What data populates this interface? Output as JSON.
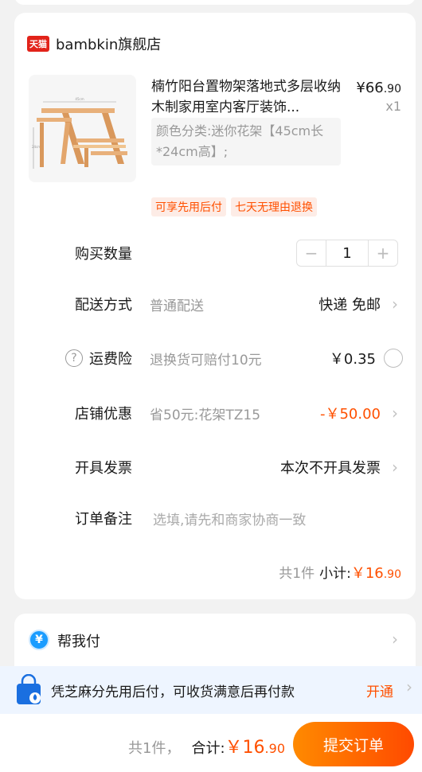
{
  "shop": {
    "badge": "天猫",
    "name": "bambkin旗舰店"
  },
  "product": {
    "title": "楠竹阳台置物架落地式多层收纳木制家用室内客厅装饰...",
    "price_symbol": "¥",
    "price_int": "66",
    "price_dec": ".90",
    "quantity_label": "x1",
    "sku": "颜色分类:迷你花架【45cm长*24cm高】;",
    "thumb_dim_top": "45cm",
    "thumb_dim_side": "24cm",
    "tags": [
      "可享先用后付",
      "七天无理由退换"
    ]
  },
  "rows": {
    "quantity": {
      "label": "购买数量",
      "minus": "−",
      "value": "1",
      "plus": "+"
    },
    "delivery": {
      "label": "配送方式",
      "desc": "普通配送",
      "value": "快递 免邮"
    },
    "insurance": {
      "label": "运费险",
      "desc": "退换货可赔付10元",
      "value": "￥0.35"
    },
    "discount": {
      "label": "店铺优惠",
      "desc": "省50元:花架TZ15",
      "value": "-￥50.00"
    },
    "invoice": {
      "label": "开具发票",
      "value": "本次不开具发票"
    },
    "note": {
      "label": "订单备注",
      "placeholder": "选填,请先和商家协商一致"
    }
  },
  "subtotal": {
    "count": "共1件",
    "label": "小计:",
    "symbol": "￥",
    "int": "16",
    "dec": ".90"
  },
  "help_pay": {
    "icon_glyph": "¥",
    "label": "帮我付"
  },
  "credit": {
    "text": "凭芝麻分先用后付，可收货满意后再付款",
    "action": "开通"
  },
  "footer": {
    "count": "共1件，",
    "label": "合计:",
    "symbol": "￥",
    "int": "16",
    "dec": ".90",
    "submit": "提交订单"
  },
  "colors": {
    "accent": "#ff5000",
    "tmall": "#e2231a",
    "pay_blue": "#1a9cff"
  },
  "icons": {
    "help": "question-circle-icon",
    "chevron": "chevron-right-icon",
    "bag": "shopping-bag-icon"
  }
}
